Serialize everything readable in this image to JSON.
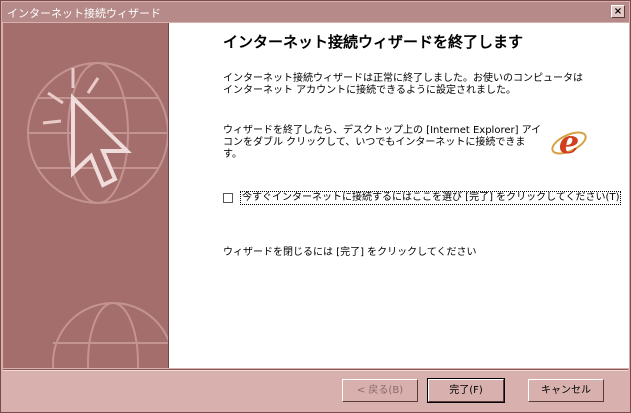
{
  "window": {
    "title": "インターネット接続ウィザード",
    "close_label": "×"
  },
  "main": {
    "heading": "インターネット接続ウィザードを終了します",
    "paragraph1": "インターネット接続ウィザードは正常に終了しました。お使いのコンピュータはインターネット アカウントに接続できるように設定されました。",
    "paragraph2": "ウィザードを終了したら、デスクトップ上の [Internet Explorer] アイコンをダブル クリックして、いつでもインターネットに接続できます。",
    "checkbox": {
      "label": "今すぐインターネットに接続するにはここを選び [完了] をクリックしてください(T)",
      "checked": false
    },
    "paragraph3": "ウィザードを閉じるには [完了] をクリックしてください"
  },
  "buttons": {
    "back": "< 戻る(B)",
    "finish": "完了(F)",
    "cancel": "キャンセル"
  },
  "colors": {
    "frame": "#d8b0ae",
    "banner": "#a46e6c",
    "ie_logo": "#d04020"
  },
  "icons": {
    "banner_art": "cursor-globe-icon",
    "ie": "internet-explorer-icon"
  }
}
